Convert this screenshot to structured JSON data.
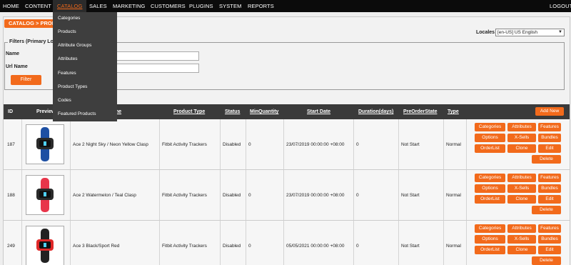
{
  "nav": {
    "items": [
      "HOME",
      "CONTENT",
      "CATALOG",
      "SALES",
      "MARKETING",
      "CUSTOMERS",
      "PLUGINS",
      "SYSTEM",
      "REPORTS"
    ],
    "logout": "LOGOUT"
  },
  "breadcrumb": "CATALOG > PRODUCTS",
  "locales": {
    "label": "Locales",
    "value": "[en-US] US English"
  },
  "filters": {
    "title": "Filters (Primary Locale)",
    "name_label": "Name",
    "url_label": "Url Name",
    "button": "Filter"
  },
  "dropdown": [
    "Categories",
    "Products",
    "Attribute Groups",
    "Attributes",
    "Features",
    "Product Types",
    "Codes",
    "Featured Products"
  ],
  "table": {
    "headers": [
      "ID",
      "Preview",
      "Name",
      "Product Type",
      "Status",
      "MinQuantity",
      "Start Date",
      "Duration(days)",
      "PreOrderState",
      "Type"
    ],
    "add_new": "Add New",
    "rows": [
      {
        "id": "187",
        "name": "Ace 2 Night Sky / Neon Yellow Clasp",
        "product_type": "Fitbit Activity Trackers",
        "status": "Disabled",
        "min_quantity": "0",
        "start_date": "23/07/2019 00:00:00 +08:00",
        "duration": "0",
        "preorder": "Not Start",
        "type": "Normal",
        "band_color": "#1d4fa3",
        "band_accent": "#2a2a2a"
      },
      {
        "id": "188",
        "name": "Ace 2 Watermelon / Teal Clasp",
        "product_type": "Fitbit Activity Trackers",
        "status": "Disabled",
        "min_quantity": "0",
        "start_date": "23/07/2019 00:00:00 +08:00",
        "duration": "0",
        "preorder": "Not Start",
        "type": "Normal",
        "band_color": "#e8354a",
        "band_accent": "#2a2a2a"
      },
      {
        "id": "249",
        "name": "Ace 3 Black/Sport Red",
        "product_type": "Fitbit Activity Trackers",
        "status": "Disabled",
        "min_quantity": "0",
        "start_date": "05/05/2021 00:00:00 +08:00",
        "duration": "0",
        "preorder": "Not Start",
        "type": "Normal",
        "band_color": "#222222",
        "band_accent": "#e02828"
      }
    ],
    "actions": [
      "Categories",
      "Attributes",
      "Features",
      "Options",
      "X-Sells",
      "Bundles",
      "OrderList",
      "Clone",
      "Edit",
      "Delete"
    ]
  },
  "colors": {
    "accent": "#f26a1b",
    "nav_bg": "#0b0b0b",
    "header_bg": "#3a3a3a"
  }
}
